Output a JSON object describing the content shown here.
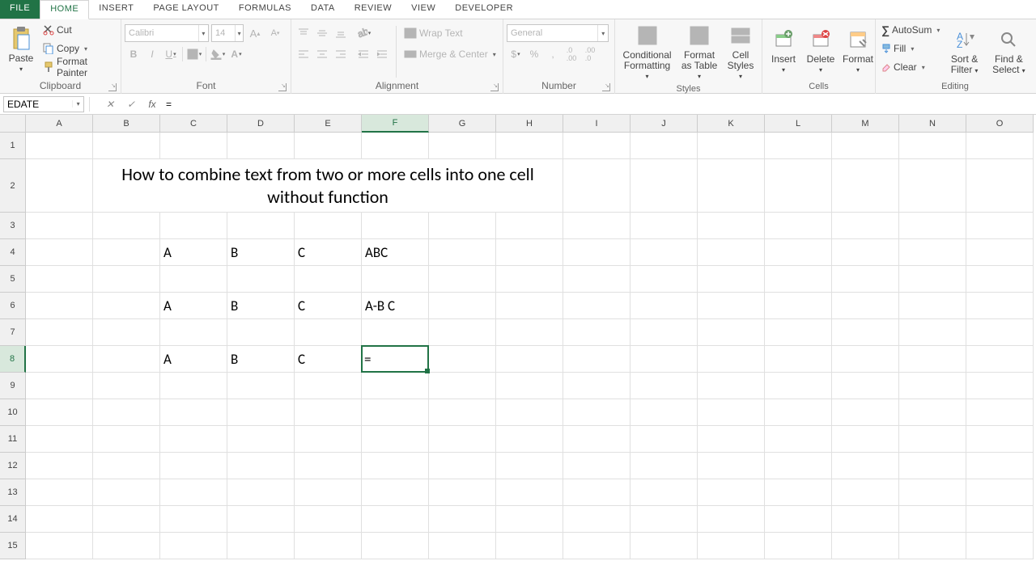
{
  "tabs": {
    "file": "FILE",
    "home": "HOME",
    "insert": "INSERT",
    "pagelayout": "PAGE LAYOUT",
    "formulas": "FORMULAS",
    "data": "DATA",
    "review": "REVIEW",
    "view": "VIEW",
    "developer": "DEVELOPER"
  },
  "clipboard": {
    "paste": "Paste",
    "cut": "Cut",
    "copy": "Copy",
    "painter": "Format Painter",
    "label": "Clipboard"
  },
  "font": {
    "name": "Calibri",
    "size": "14",
    "label": "Font"
  },
  "alignment": {
    "wrap": "Wrap Text",
    "merge": "Merge & Center",
    "label": "Alignment"
  },
  "number": {
    "format": "General",
    "label": "Number"
  },
  "styles": {
    "cond": "Conditional Formatting",
    "table": "Format as Table",
    "cell": "Cell Styles",
    "label": "Styles"
  },
  "cells_grp": {
    "insert": "Insert",
    "delete": "Delete",
    "format": "Format",
    "label": "Cells"
  },
  "editing": {
    "autosum": "AutoSum",
    "fill": "Fill",
    "clear": "Clear",
    "sort": "Sort & Filter",
    "find": "Find & Select",
    "label": "Editing"
  },
  "namebox": "EDATE",
  "formula": "=",
  "columns": [
    "A",
    "B",
    "C",
    "D",
    "E",
    "F",
    "G",
    "H",
    "I",
    "J",
    "K",
    "L",
    "M",
    "N",
    "O"
  ],
  "rows": [
    "1",
    "2",
    "3",
    "4",
    "5",
    "6",
    "7",
    "8",
    "9",
    "10",
    "11",
    "12",
    "13",
    "14",
    "15"
  ],
  "active": {
    "col": "F",
    "row": "8",
    "value": "="
  },
  "sheet": {
    "B2": "How to combine text from two or more cells into one cell without function",
    "C4": "A",
    "D4": "B",
    "E4": "C",
    "F4": "ABC",
    "C6": "A",
    "D6": "B",
    "E6": "C",
    "F6": "A-B C",
    "C8": "A",
    "D8": "B",
    "E8": "C"
  },
  "chart_data": null
}
